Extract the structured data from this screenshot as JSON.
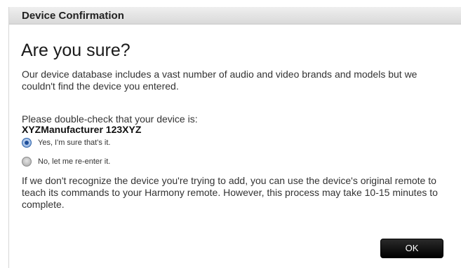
{
  "dialog": {
    "title": "Device Confirmation",
    "heading": "Are you sure?",
    "intro_text": "Our device database includes a vast number of audio and video brands and models but we couldn't find the device you entered.",
    "check_prompt": "Please double-check that your device is:",
    "device_name": "XYZManufacturer 123XYZ",
    "options": [
      {
        "label": "Yes, I'm sure that's it.",
        "selected": true
      },
      {
        "label": "No, let me re-enter it.",
        "selected": false
      }
    ],
    "help_text": "If we don't recognize the device you're trying to add, you can use the device's original remote to teach its commands to your Harmony remote. However, this process may take 10-15 minutes to complete.",
    "ok_label": "OK"
  },
  "colors": {
    "button_bg": "#000000",
    "radio_selected": "#2f63a8",
    "titlebar_bg": "#e3e3e3"
  }
}
